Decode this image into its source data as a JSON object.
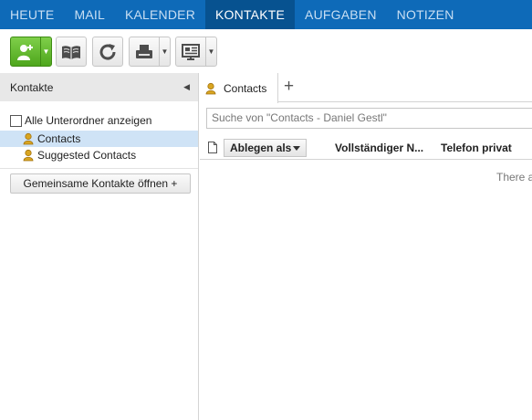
{
  "nav": {
    "items": [
      {
        "label": "HEUTE",
        "active": false
      },
      {
        "label": "MAIL",
        "active": false
      },
      {
        "label": "KALENDER",
        "active": false
      },
      {
        "label": "KONTAKTE",
        "active": true
      },
      {
        "label": "AUFGABEN",
        "active": false
      },
      {
        "label": "NOTIZEN",
        "active": false
      }
    ],
    "active_color": "#075290",
    "bar_color": "#0e6ab8"
  },
  "toolbar": {
    "buttons": [
      {
        "icon": "add-contact-icon",
        "has_split": true
      },
      {
        "icon": "address-book-icon",
        "has_split": false
      },
      {
        "icon": "refresh-icon",
        "has_split": false
      },
      {
        "icon": "print-icon",
        "has_split": true
      },
      {
        "icon": "view-icon",
        "has_split": true
      }
    ]
  },
  "sidebar": {
    "title": "Kontakte",
    "show_subfolders_label": "Alle Unterordner anzeigen",
    "folders": [
      {
        "label": "Contacts",
        "selected": true
      },
      {
        "label": "Suggested Contacts",
        "selected": false
      }
    ],
    "shared_button": "Gemeinsame Kontakte öffnen +"
  },
  "main": {
    "tab_label": "Contacts",
    "add_tab": "+",
    "search_placeholder": "Suche von \"Contacts - Daniel Gestl\"",
    "sort_label": "Ablegen als",
    "columns": [
      "Vollständiger N...",
      "Telefon privat"
    ],
    "empty_text": "There a"
  }
}
